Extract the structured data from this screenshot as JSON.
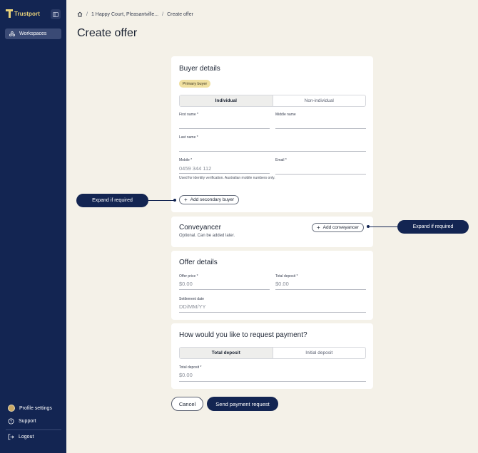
{
  "sidebar": {
    "brand": "Trustport",
    "nav_active": "Workspaces",
    "profile_settings": "Profile settings",
    "support": "Support",
    "logout": "Logout"
  },
  "breadcrumb": {
    "address": "1 Happy Court, Pleasantville...",
    "current": "Create offer"
  },
  "page_title": "Create offer",
  "buyer": {
    "title": "Buyer details",
    "badge": "Primary buyer",
    "types": [
      "Individual",
      "Non-individual"
    ],
    "first_name_label": "First name *",
    "middle_name_label": "Middle name",
    "last_name_label": "Last name *",
    "mobile_label": "Mobile *",
    "mobile_placeholder": "0459 344 112",
    "mobile_hint": "Used for identity verification. Australian mobile numbers only.",
    "email_label": "Email *",
    "add_secondary": "Add secondary buyer"
  },
  "conveyancer": {
    "title": "Conveyancer",
    "subtitle": "Optional. Can be added later.",
    "add": "Add conveyancer"
  },
  "offer": {
    "title": "Offer details",
    "offer_price_label": "Offer price *",
    "offer_price_placeholder": "$0.00",
    "total_deposit_label": "Total deposit *",
    "total_deposit_placeholder": "$0.00",
    "settlement_label": "Settlement date",
    "settlement_placeholder": "DD/MM/YY"
  },
  "payment": {
    "title": "How would you like to request payment?",
    "types": [
      "Total deposit",
      "Initial deposit"
    ],
    "deposit_label": "Total deposit *",
    "deposit_placeholder": "$0.00"
  },
  "callouts": {
    "left": "Expand if required",
    "right": "Expand if required"
  },
  "actions": {
    "cancel": "Cancel",
    "send": "Send payment request"
  }
}
